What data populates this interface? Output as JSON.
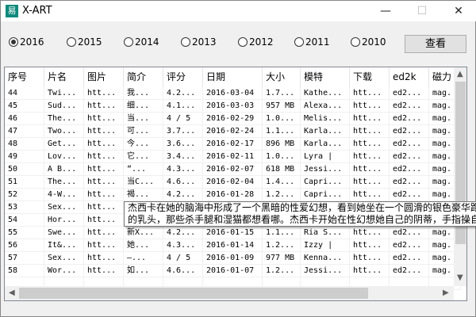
{
  "window": {
    "title": "X-ART",
    "icon": "app-icon",
    "minimize": "—",
    "maximize": "☐",
    "close": "✕"
  },
  "years": [
    {
      "label": "2016",
      "selected": true
    },
    {
      "label": "2015",
      "selected": false
    },
    {
      "label": "2014",
      "selected": false
    },
    {
      "label": "2013",
      "selected": false
    },
    {
      "label": "2012",
      "selected": false
    },
    {
      "label": "2011",
      "selected": false
    },
    {
      "label": "2010",
      "selected": false
    }
  ],
  "view_button": "查看",
  "table": {
    "columns": [
      "序号",
      "片名",
      "图片",
      "简介",
      "评分",
      "日期",
      "大小",
      "模特",
      "下载",
      "ed2k",
      "磁力"
    ],
    "rows": [
      [
        "44",
        "Twi...",
        "htt...",
        "我...",
        "4.2...",
        "2016-03-04",
        "1.7...",
        "Kathe...",
        "htt...",
        "ed2...",
        "mag."
      ],
      [
        "45",
        "Sud...",
        "htt...",
        "细...",
        "4.1...",
        "2016-03-03",
        "957 MB",
        "Alexa...",
        "htt...",
        "ed2...",
        "mag."
      ],
      [
        "46",
        "The...",
        "htt...",
        "当...",
        "4 / 5",
        "2016-02-29",
        "1.0...",
        "Melis...",
        "htt...",
        "ed2...",
        "mag."
      ],
      [
        "47",
        "Two...",
        "htt...",
        "可...",
        "3.7...",
        "2016-02-24",
        "1.1...",
        "Karla...",
        "htt...",
        "ed2...",
        "mag."
      ],
      [
        "48",
        "Get...",
        "htt...",
        "今...",
        "3.6...",
        "2016-02-17",
        "896 MB",
        "Karla...",
        "htt...",
        "ed2...",
        "mag."
      ],
      [
        "49",
        "Lov...",
        "htt...",
        "它...",
        "3.4...",
        "2016-02-11",
        "1.0...",
        "Lyra |",
        "htt...",
        "ed2...",
        "mag."
      ],
      [
        "50",
        "A B...",
        "htt...",
        "“...",
        "4.3...",
        "2016-02-07",
        "618 MB",
        "Jessi...",
        "htt...",
        "ed2...",
        "mag."
      ],
      [
        "51",
        "The...",
        "htt...",
        "当C...",
        "4.6...",
        "2016-02-04",
        "1.4...",
        "Capri...",
        "htt...",
        "ed2...",
        "mag."
      ],
      [
        "52",
        "4-W...",
        "htt...",
        "褐...",
        "4.2...",
        "2016-01-28",
        "1.2...",
        "Capri...",
        "htt...",
        "ed2...",
        "mag."
      ],
      [
        "53",
        "Sex...",
        "htt...",
        "",
        "",
        "",
        "",
        "",
        "",
        "",
        ""
      ],
      [
        "54",
        "Hor...",
        "htt...",
        "",
        "",
        "",
        "",
        "",
        "",
        "",
        ""
      ],
      [
        "55",
        "Swe...",
        "htt...",
        "新X...",
        "4.2...",
        "2016-01-15",
        "1.1...",
        "Ria S...",
        "htt...",
        "ed2...",
        "mag."
      ],
      [
        "56",
        "It&...",
        "htt...",
        "她...",
        "4.3...",
        "2016-01-14",
        "1.2...",
        "Izzy |",
        "htt...",
        "ed2...",
        "mag."
      ],
      [
        "57",
        "Sex...",
        "htt...",
        "—...",
        "4 / 5",
        "2016-01-09",
        "977 MB",
        "Kenna...",
        "htt...",
        "ed2...",
        "mag."
      ],
      [
        "58",
        "Wor...",
        "htt...",
        "如...",
        "4.6...",
        "2016-01-07",
        "1.2...",
        "Jessi...",
        "htt...",
        "ed2...",
        "mag."
      ]
    ]
  },
  "tooltip": {
    "line1": "杰西卡在她的脑海中形成了一个黑暗的性爱幻想，看到她坐在一个圆滑的银色豪华跑",
    "line2": "的乳头，那些杀手腿和湿猫都想看哪。杰西卡开始在性幻想她自己的阴蒂，手指操自"
  }
}
